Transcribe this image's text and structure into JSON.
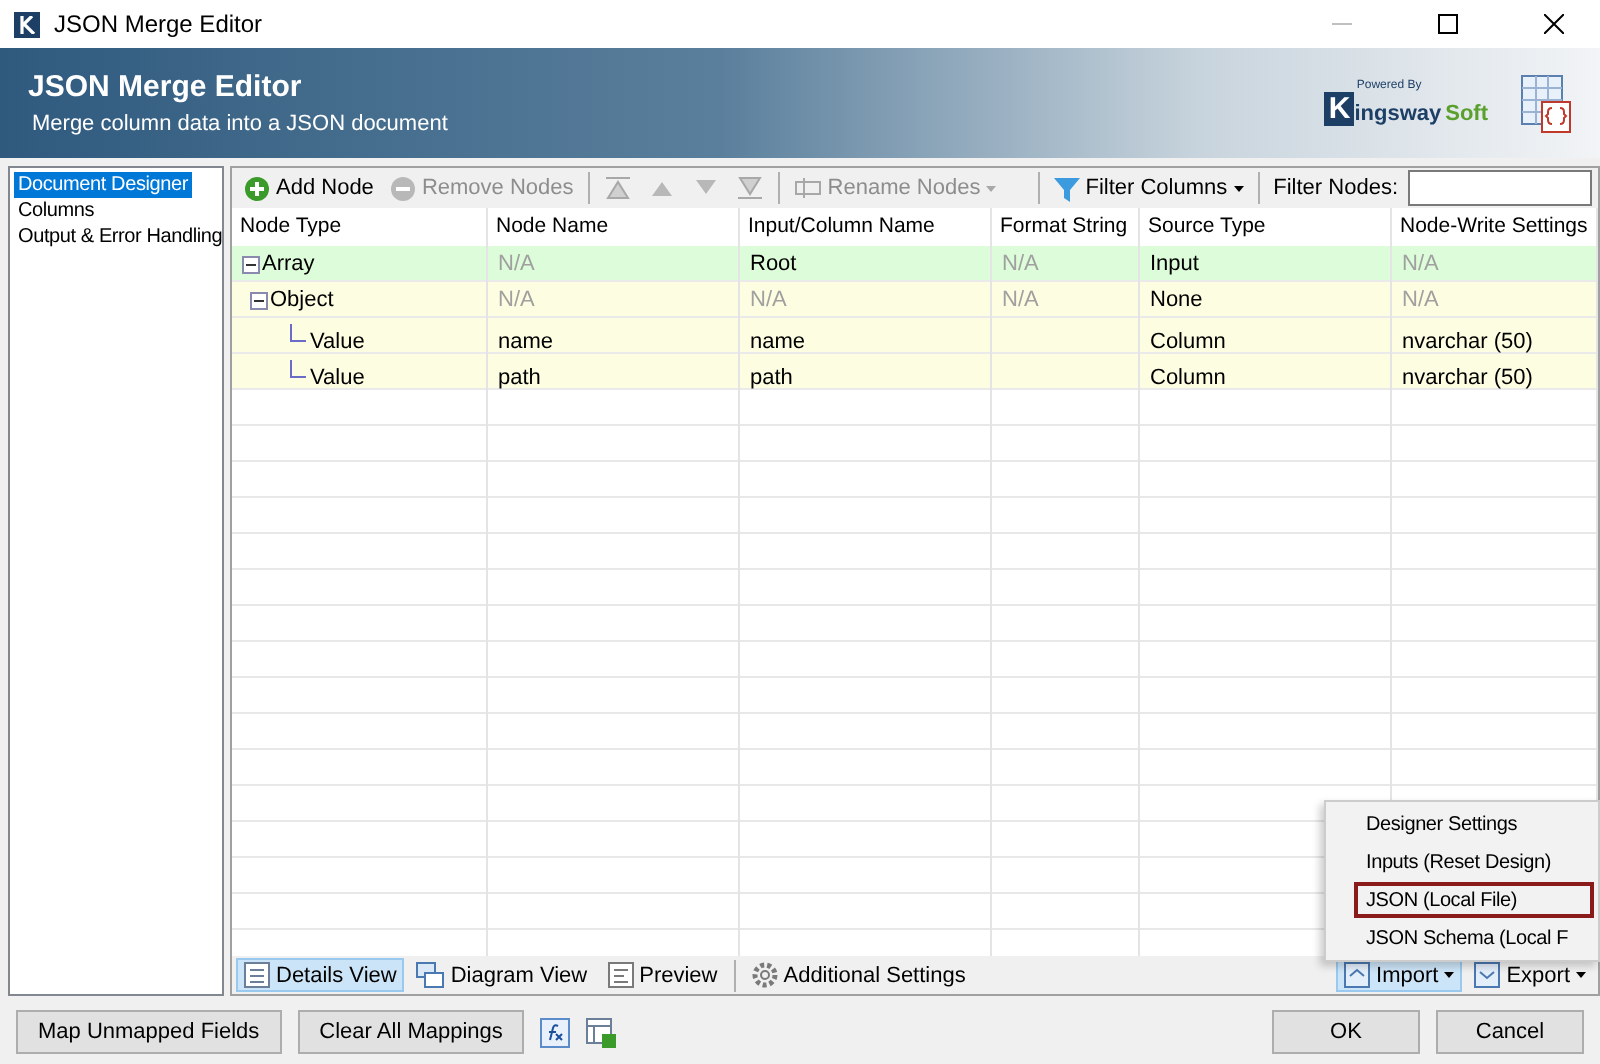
{
  "window": {
    "title": "JSON Merge Editor"
  },
  "banner": {
    "title": "JSON Merge Editor",
    "subtitle": "Merge column data into a JSON document",
    "logo": {
      "powered": "Powered By",
      "initial": "K",
      "name": "ingsway",
      "suffix": "Soft"
    }
  },
  "sidebar": {
    "items": [
      {
        "label": "Document Designer",
        "selected": true
      },
      {
        "label": "Columns",
        "selected": false
      },
      {
        "label": "Output & Error Handling",
        "selected": false
      }
    ]
  },
  "toolbar": {
    "items": [
      {
        "kind": "add",
        "label": "Add Node",
        "disabled": false
      },
      {
        "kind": "remove",
        "label": "Remove Nodes",
        "disabled": true
      },
      {
        "kind": "sep"
      },
      {
        "kind": "top",
        "disabled": true
      },
      {
        "kind": "up",
        "disabled": true
      },
      {
        "kind": "down",
        "disabled": true
      },
      {
        "kind": "bottom",
        "disabled": true
      },
      {
        "kind": "sep"
      },
      {
        "kind": "rename",
        "label": "Rename Nodes",
        "disabled": true
      }
    ],
    "filter_columns": "Filter Columns",
    "filter_nodes": {
      "label": "Filter Nodes:"
    }
  },
  "table": {
    "columns": [
      "Node Type",
      "Node Name",
      "Input/Column Name",
      "Format String",
      "Source Type",
      "Node-Write Settings"
    ],
    "rows": [
      {
        "kind": "root",
        "expanded": true,
        "cells": [
          {
            "text": "Array",
            "disabled": false
          },
          {
            "text": "N/A",
            "disabled": true
          },
          {
            "text": "Root",
            "disabled": false
          },
          {
            "text": "N/A",
            "disabled": true
          },
          {
            "text": "Input",
            "disabled": false
          },
          {
            "text": "N/A",
            "disabled": true
          }
        ],
        "children": [
          {
            "kind": "child",
            "expanded": true,
            "cells": [
              {
                "text": "Object",
                "disabled": false
              },
              {
                "text": "N/A",
                "disabled": true
              },
              {
                "text": "N/A",
                "disabled": true
              },
              {
                "text": "N/A",
                "disabled": true
              },
              {
                "text": "None",
                "disabled": false
              },
              {
                "text": "N/A",
                "disabled": true
              }
            ],
            "children": [
              {
                "kind": "child",
                "cells": [
                  {
                    "text": "Value",
                    "disabled": false
                  },
                  {
                    "text": "name",
                    "disabled": false
                  },
                  {
                    "text": "name",
                    "disabled": false
                  },
                  null,
                  {
                    "text": "Column",
                    "disabled": false
                  },
                  {
                    "text": "nvarchar (50)",
                    "disabled": false
                  }
                ]
              },
              {
                "kind": "child",
                "cells": [
                  {
                    "text": "Value",
                    "disabled": false
                  },
                  {
                    "text": "path",
                    "disabled": false
                  },
                  {
                    "text": "path",
                    "disabled": false
                  },
                  null,
                  {
                    "text": "Column",
                    "disabled": false
                  },
                  {
                    "text": "nvarchar (50)",
                    "disabled": false
                  }
                ]
              }
            ]
          }
        ]
      }
    ]
  },
  "view_tabs": [
    {
      "kind": "details",
      "label": "Details View",
      "selected": true
    },
    {
      "kind": "diagram",
      "label": "Diagram View",
      "selected": false
    },
    {
      "kind": "preview",
      "label": "Preview",
      "selected": false
    },
    {
      "kind": "settings",
      "label": "Additional Settings",
      "selected": false
    }
  ],
  "import_menu": {
    "import": {
      "label": "Import",
      "pressed": true
    },
    "export": {
      "label": "Export",
      "pressed": false
    },
    "items": [
      {
        "label": "Designer Settings",
        "selected": false
      },
      {
        "label": "Inputs (Reset Design)",
        "selected": false
      },
      {
        "label": "JSON (Local File)",
        "selected": true
      },
      {
        "label": "JSON Schema (Local F",
        "selected": false
      }
    ]
  },
  "footer": {
    "left_buttons": [
      "Map Unmapped Fields",
      "Clear All Mappings"
    ],
    "right_buttons": [
      "OK",
      "Cancel"
    ]
  }
}
